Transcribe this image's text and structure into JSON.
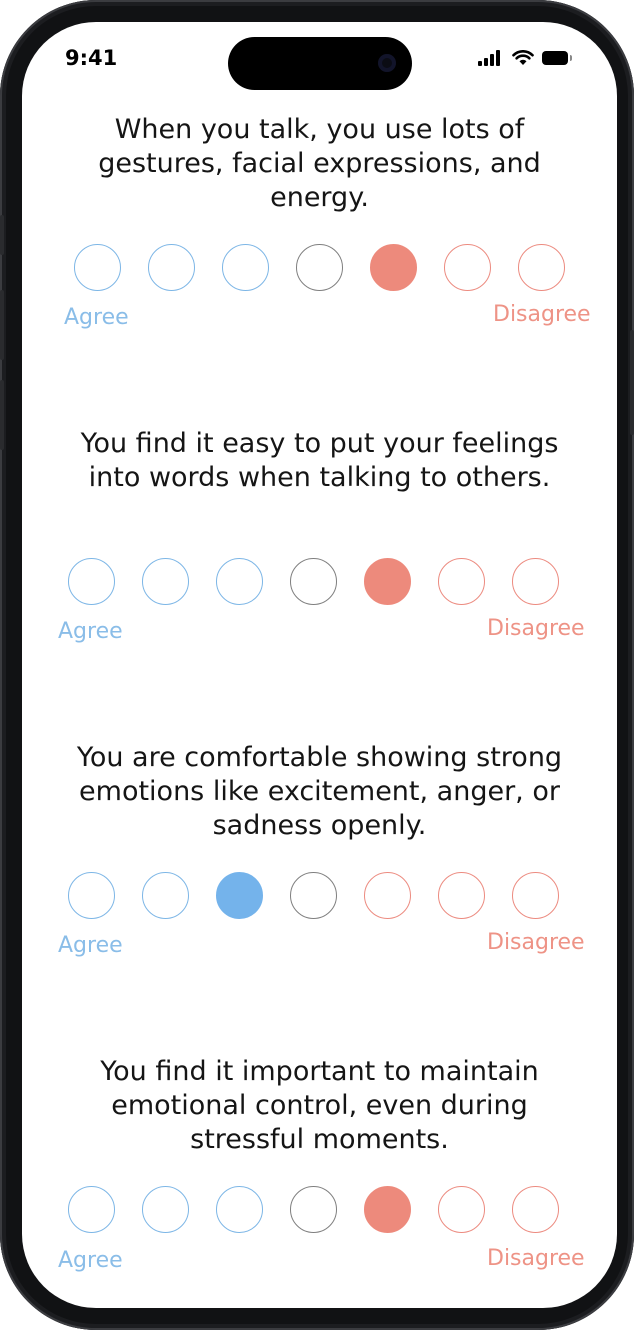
{
  "colors": {
    "agree": "#7db6e6",
    "neutral": "#7f7f7f",
    "disagree": "#ec8b80",
    "selected_agree": "#74b3eb",
    "selected_disagree": "#ed8a7c"
  },
  "status_bar": {
    "time": "9:41",
    "icons": [
      "signal-icon",
      "wifi-icon",
      "battery-icon"
    ]
  },
  "scale": {
    "agree_label": "Agree",
    "disagree_label": "Disagree",
    "option_count": 7
  },
  "questions": [
    {
      "text": "When you talk, you use lots of gestures, facial expressions, and energy.",
      "selected_option": 5
    },
    {
      "text": "You find it easy to put your feelings into words when talking to others.",
      "selected_option": 5
    },
    {
      "text": "You are comfortable showing strong emotions like excitement, anger, or sadness openly.",
      "selected_option": 3
    },
    {
      "text": "You find it important to maintain emotional control, even during stressful moments.",
      "selected_option": 5
    }
  ]
}
